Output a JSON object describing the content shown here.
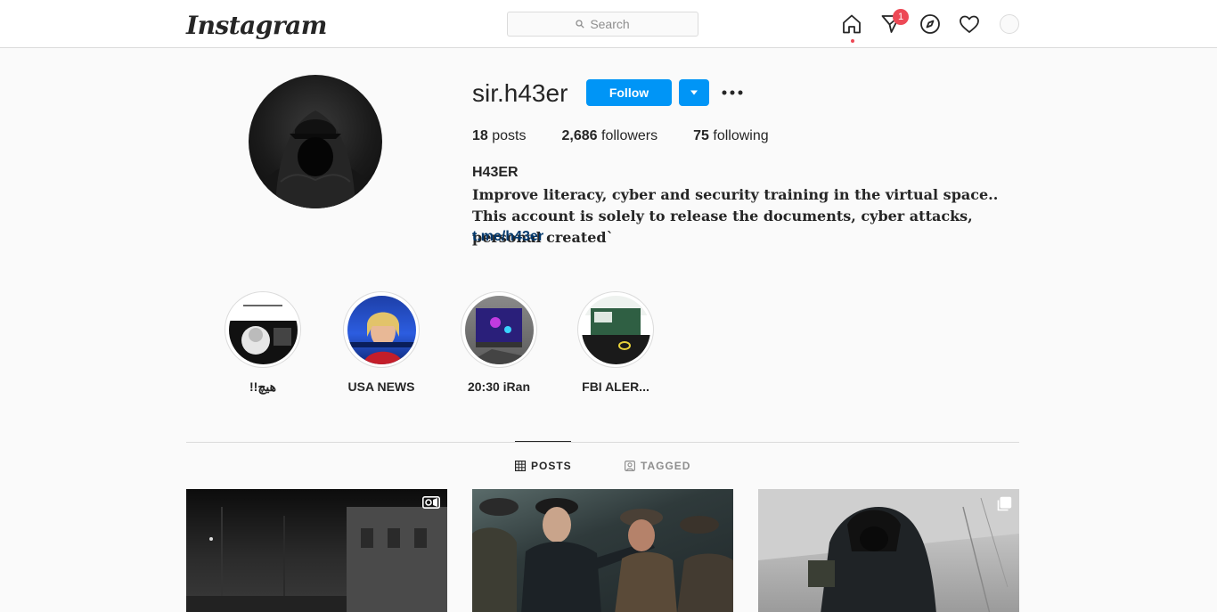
{
  "header": {
    "logo": "Instagram",
    "search_placeholder": "Search",
    "direct_badge": "1"
  },
  "profile": {
    "username": "sir.h43er",
    "follow_label": "Follow",
    "stats": [
      {
        "value": "18",
        "label": "posts"
      },
      {
        "value": "2,686",
        "label": "followers"
      },
      {
        "value": "75",
        "label": "following"
      }
    ],
    "full_name": "H43ER",
    "bio": "Improve literacy, cyber and security training in the virtual space.. This account is solely to release the documents, cyber attacks, personal created`",
    "link": "t.me/h43er"
  },
  "highlights": [
    {
      "label": "!!هیچ"
    },
    {
      "label": "USA NEWS"
    },
    {
      "label": "20:30 iRan"
    },
    {
      "label": "FBI ALER..."
    }
  ],
  "tabs": [
    {
      "label": "POSTS",
      "active": true
    },
    {
      "label": "TAGGED",
      "active": false
    }
  ],
  "posts": [
    {
      "type": "video",
      "icon": "video-icon"
    },
    {
      "type": "image",
      "icon": ""
    },
    {
      "type": "carousel",
      "icon": "carousel-icon"
    }
  ],
  "colors": {
    "accent": "#0095f6",
    "link": "#00376b",
    "notification": "#ed4956"
  }
}
